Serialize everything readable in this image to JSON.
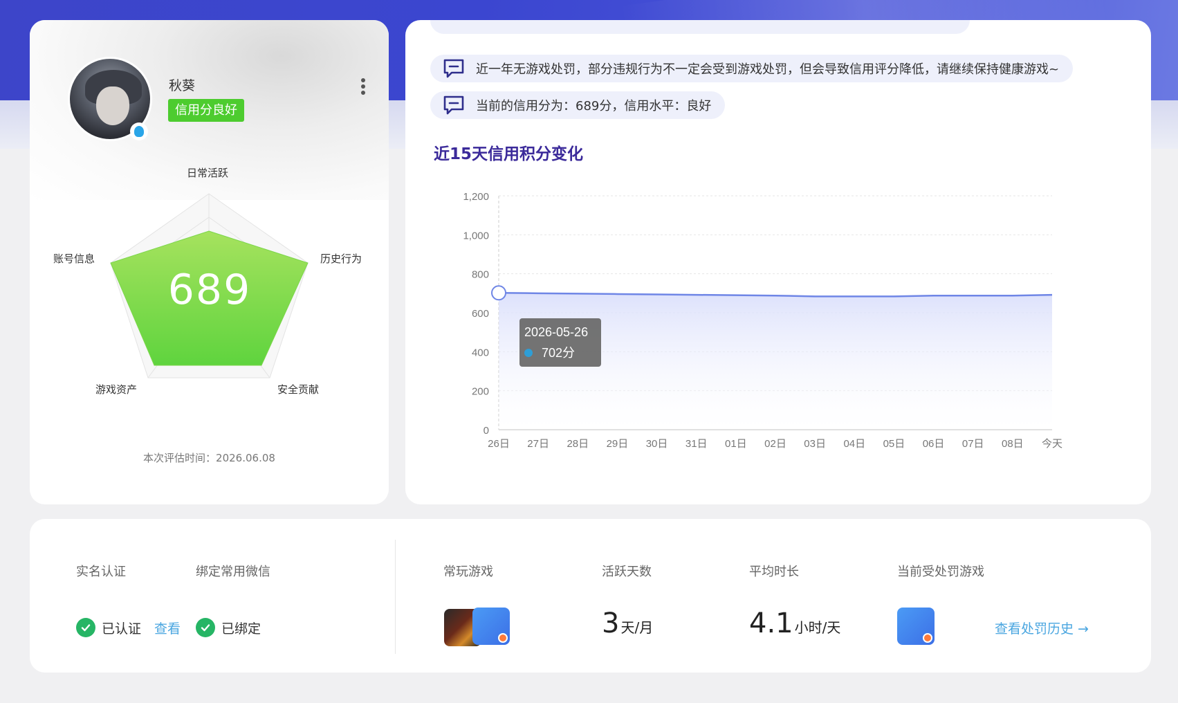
{
  "profile": {
    "username": "秋葵",
    "credit_badge": "信用分良好",
    "score": "689",
    "radar": {
      "labels": {
        "daily": "日常活跃",
        "history": "历史行为",
        "security": "安全贡献",
        "assets": "游戏资产",
        "account": "账号信息"
      }
    },
    "eval_time": "本次评估时间：2026.06.08"
  },
  "notices": [
    "近一年无游戏处罚，部分违规行为不一定会受到游戏处罚，但会导致信用评分降低，请继续保持健康游戏~",
    "当前的信用分为：689分，信用水平：良好"
  ],
  "chart_section_title": "近15天信用积分变化",
  "chart_data": {
    "type": "area",
    "title": "近15天信用积分变化",
    "categories": [
      "26日",
      "27日",
      "28日",
      "29日",
      "30日",
      "31日",
      "01日",
      "02日",
      "03日",
      "04日",
      "05日",
      "06日",
      "07日",
      "08日",
      "今天"
    ],
    "series": [
      {
        "values": [
          702,
          700,
          698,
          696,
          694,
          692,
          690,
          688,
          684,
          684,
          684,
          688,
          688,
          688,
          692
        ]
      }
    ],
    "yticks": [
      "0",
      "200",
      "400",
      "600",
      "800",
      "1,000",
      "1,200"
    ],
    "ylim": [
      0,
      1200
    ],
    "grid": true,
    "tooltip": {
      "date": "2026-05-26",
      "value": "702分"
    },
    "colors": {
      "line": "#6f86e6",
      "area_top": "#d9defb",
      "tooltip_dot": "#2e9ed6"
    }
  },
  "stats": {
    "realname": {
      "label": "实名认证",
      "status": "已认证",
      "link": "查看"
    },
    "wechat": {
      "label": "绑定常用微信",
      "status": "已绑定"
    },
    "games": {
      "label": "常玩游戏"
    },
    "active_days": {
      "label": "活跃天数",
      "value": "3",
      "unit": "天/月"
    },
    "avg_time": {
      "label": "平均时长",
      "value": "4.1",
      "unit": "小时/天"
    },
    "punished": {
      "label": "当前受处罚游戏",
      "link": "查看处罚历史 →"
    }
  }
}
